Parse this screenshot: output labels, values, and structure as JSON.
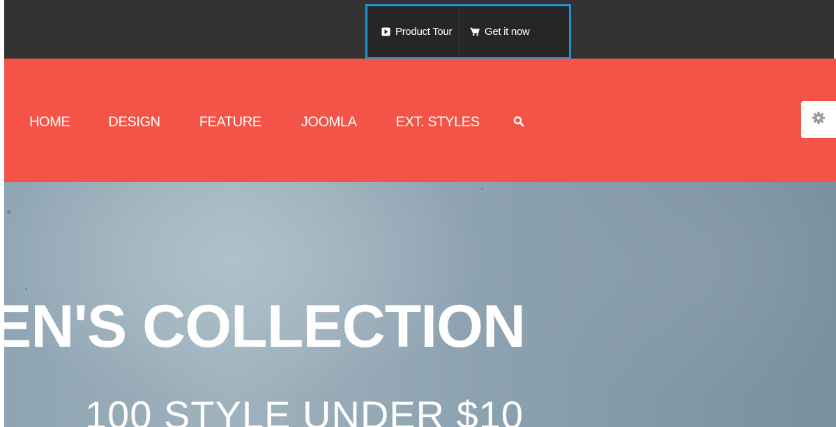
{
  "topbar": {
    "product_tour_label": "Product Tour",
    "product_tour_icon": "play-square-icon",
    "get_it_now_label": "Get it now",
    "get_it_now_icon": "cart-icon",
    "highlight_color": "#1e95d4"
  },
  "nav": {
    "background_color": "#f45447",
    "items": [
      {
        "label": "HOME"
      },
      {
        "label": "DESIGN"
      },
      {
        "label": "FEATURE"
      },
      {
        "label": "JOOMLA"
      },
      {
        "label": "EXT. STYLES"
      }
    ],
    "search_icon": "search-icon",
    "settings_icon": "gear-icon"
  },
  "hero": {
    "title": "EN'S COLLECTION",
    "subtitle": "100 STYLE UNDER $10"
  }
}
